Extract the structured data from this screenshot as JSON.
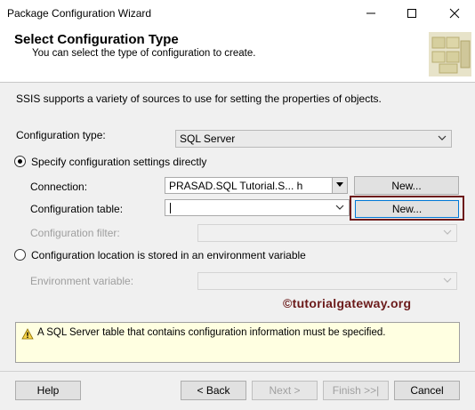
{
  "window": {
    "title": "Package Configuration Wizard",
    "minimize_icon": "minimize-icon",
    "maximize_icon": "maximize-icon",
    "close_icon": "close-icon"
  },
  "header": {
    "title": "Select Configuration Type",
    "subtitle": "You can select the type of configuration to create."
  },
  "intro": "SSIS supports a variety of sources to use for setting the properties of objects.",
  "config_type": {
    "label": "Configuration type:",
    "value": "SQL Server"
  },
  "option_direct": {
    "label": "Specify configuration settings directly",
    "selected": true,
    "connection": {
      "label": "Connection:",
      "value": "PRASAD.SQL Tutorial.S...   h",
      "new_label": "New..."
    },
    "config_table": {
      "label": "Configuration table:",
      "value": "",
      "new_label": "New..."
    },
    "config_filter": {
      "label": "Configuration filter:",
      "value": ""
    }
  },
  "option_env": {
    "label": "Configuration location is stored in an environment variable",
    "selected": false,
    "env_var": {
      "label": "Environment variable:",
      "value": ""
    }
  },
  "watermark": "©tutorialgateway.org",
  "message": "A SQL Server table that contains configuration information must be specified.",
  "footer": {
    "help": "Help",
    "back": "< Back",
    "next": "Next >",
    "finish": "Finish >>|",
    "cancel": "Cancel"
  },
  "colors": {
    "highlight": "#6d1b1b",
    "message_bg": "#ffffe1",
    "watermark": "#6b1a1a"
  }
}
